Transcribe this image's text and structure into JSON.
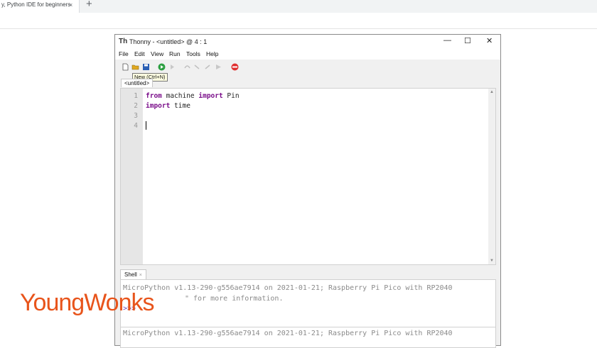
{
  "browser": {
    "tab_title": "y, Python IDE for beginners",
    "tab_close": "×",
    "new_tab": "+"
  },
  "window": {
    "title": "Thonny  -  <untitled>  @  4 : 1",
    "icon": "Th",
    "minimize": "—",
    "maximize": "☐",
    "close": "✕"
  },
  "menu": [
    "File",
    "Edit",
    "View",
    "Run",
    "Tools",
    "Help"
  ],
  "toolbar": {
    "icons": [
      "new-file-icon",
      "open-folder-icon",
      "save-icon",
      "run-icon",
      "debug-icon",
      "step-over-icon",
      "step-into-icon",
      "step-out-icon",
      "resume-icon",
      "stop-icon"
    ],
    "tooltip": "New (Ctrl+N)",
    "colors": {
      "run": "#2ea043",
      "stop": "#e03030",
      "save": "#2b5fb4",
      "folder": "#e0a820"
    }
  },
  "editor": {
    "tab_label": "<untitled>",
    "line_numbers": [
      "1",
      "2",
      "3",
      "4"
    ],
    "lines": [
      {
        "kw1": "from",
        "mid": " machine ",
        "kw2": "import",
        "rest": " Pin"
      },
      {
        "kw1": "import",
        "mid": " time",
        "kw2": "",
        "rest": ""
      },
      {
        "kw1": "",
        "mid": "",
        "kw2": "",
        "rest": ""
      },
      {
        "kw1": "",
        "mid": "",
        "kw2": "",
        "rest": ""
      }
    ]
  },
  "shell": {
    "tab_label": "Shell",
    "tab_close": "×",
    "line1": "MicroPython v1.13-290-g556ae7914 on 2021-01-21; Raspberry Pi Pico with RP2040",
    "line2": "\" for more information.",
    "prompt": ">>>",
    "line3": "MicroPython v1.13-290-g556ae7914 on 2021-01-21; Raspberry Pi Pico with RP2040"
  },
  "watermark": "YoungWonks"
}
